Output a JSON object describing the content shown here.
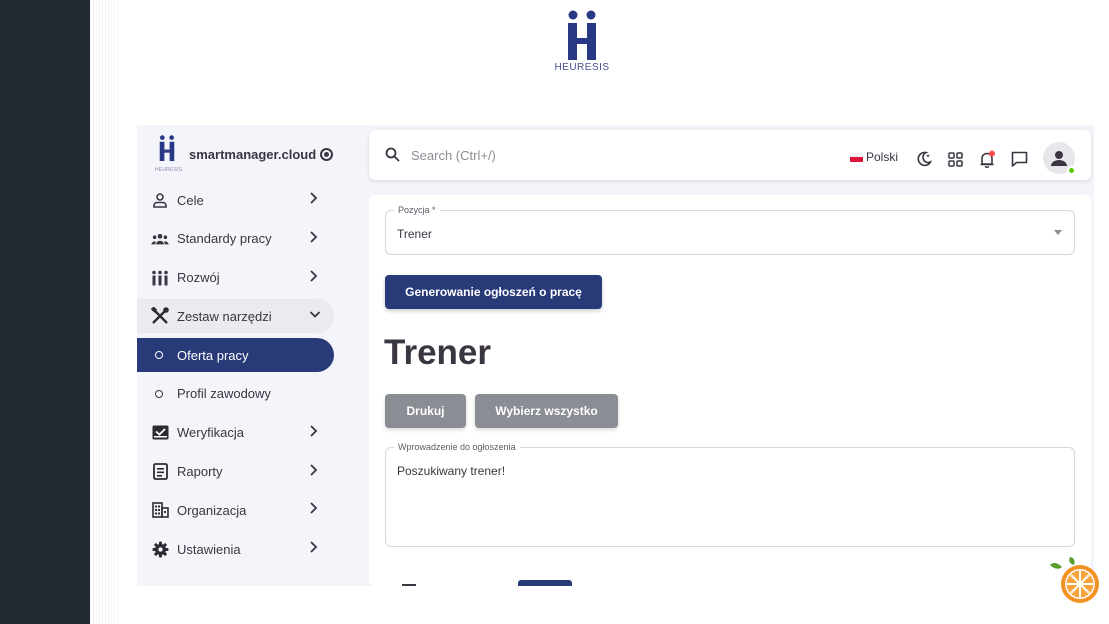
{
  "brand": {
    "logo_text": "HEURESIS",
    "mini_logo_text": "HEURESIS",
    "site_name": "smartmanager.cloud"
  },
  "sidebar": {
    "items": [
      {
        "label": "Cele",
        "icon": "user-icon",
        "has_chevron": true
      },
      {
        "label": "Standardy pracy",
        "icon": "group-icon",
        "has_chevron": true
      },
      {
        "label": "Rozwój",
        "icon": "people-row-icon",
        "has_chevron": true
      },
      {
        "label": "Zestaw narzędzi",
        "icon": "tools-icon",
        "expanded": true
      },
      {
        "label": "Oferta pracy",
        "icon": "circle-icon",
        "active": true
      },
      {
        "label": "Profil zawodowy",
        "icon": "circle-icon"
      },
      {
        "label": "Weryfikacja",
        "icon": "inbox-check-icon",
        "has_chevron": true
      },
      {
        "label": "Raporty",
        "icon": "document-icon",
        "has_chevron": true
      },
      {
        "label": "Organizacja",
        "icon": "building-icon",
        "has_chevron": true
      },
      {
        "label": "Ustawienia",
        "icon": "gear-icon",
        "has_chevron": true
      }
    ]
  },
  "topbar": {
    "search_placeholder": "Search (Ctrl+/)",
    "language": "Polski",
    "icons": [
      "moon-icon",
      "grid-icon",
      "bell-icon",
      "chat-icon",
      "avatar-icon"
    ]
  },
  "form": {
    "position_label": "Pozycja *",
    "position_value": "Trener",
    "generate_button": "Generowanie ogłoszeń o pracę",
    "heading": "Trener",
    "print_button": "Drukuj",
    "select_all_button": "Wybierz wszystko",
    "intro_label": "Wprowadzenie do ogłoszenia",
    "intro_value": "Poszukiwany trener!"
  },
  "colors": {
    "accent": "#293a79",
    "grey_button": "#8a8d93",
    "sidebar_dark": "#232a31",
    "notification_dot": "#ff4c51",
    "online_dot": "#56ca00"
  }
}
